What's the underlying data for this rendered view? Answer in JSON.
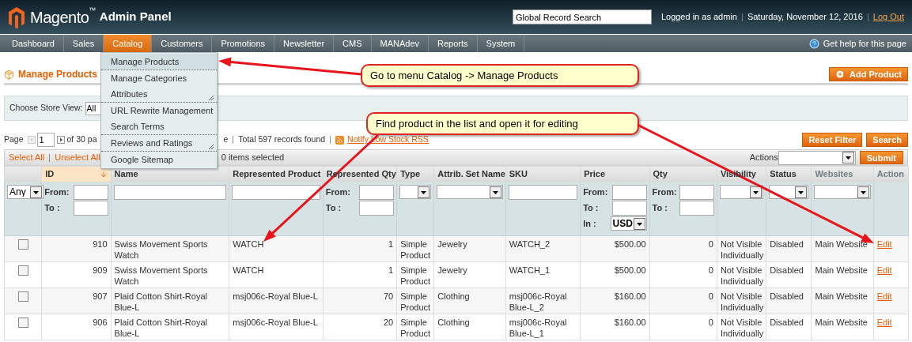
{
  "header": {
    "logo": "Magento",
    "trademark": "™",
    "logo_suffix": "Admin Panel",
    "search": {
      "value": "Global Record Search"
    },
    "user": "Logged in as admin",
    "date": "Saturday, November 12, 2016",
    "logout": "Log Out"
  },
  "nav": {
    "items": [
      {
        "label": "Dashboard",
        "selected": false
      },
      {
        "label": "Sales",
        "selected": false
      },
      {
        "label": "Catalog",
        "selected": true
      },
      {
        "label": "Customers",
        "selected": false
      },
      {
        "label": "Promotions",
        "selected": false
      },
      {
        "label": "Newsletter",
        "selected": false
      },
      {
        "label": "CMS",
        "selected": false
      },
      {
        "label": "MANAdev",
        "selected": false
      },
      {
        "label": "Reports",
        "selected": false
      },
      {
        "label": "System",
        "selected": false
      }
    ],
    "help": "Get help for this page"
  },
  "menu": {
    "groups": [
      {
        "items": [
          {
            "label": "Manage Products",
            "selected": true,
            "grip": false
          }
        ]
      },
      {
        "items": [
          {
            "label": "Manage Categories",
            "selected": false,
            "grip": false
          },
          {
            "label": "Attributes",
            "selected": false,
            "grip": true
          }
        ]
      },
      {
        "items": [
          {
            "label": "URL Rewrite Management",
            "selected": false,
            "grip": false
          },
          {
            "label": "Search Terms",
            "selected": false,
            "grip": false
          }
        ]
      },
      {
        "items": [
          {
            "label": "Reviews and Ratings",
            "selected": false,
            "grip": true
          }
        ]
      },
      {
        "items": [
          {
            "label": "Google Sitemap",
            "selected": false,
            "grip": false
          }
        ]
      }
    ]
  },
  "page_title": "Manage Products",
  "add_button": "Add Product",
  "store_view": {
    "label": "Choose Store View:",
    "value": "All"
  },
  "pager": {
    "label": "Page",
    "page": "1",
    "of": "of 30 pa",
    "after": "e",
    "total": "Total 597 records found",
    "rss": "Notify Low Stock RSS"
  },
  "filter_buttons": [
    "Reset Filter",
    "Search"
  ],
  "massaction": {
    "select_all": "Select All",
    "unselect_all": "Unselect All",
    "count": "0 items selected",
    "actions_label": "Actions",
    "submit": "Submit"
  },
  "table": {
    "columns": [
      {
        "label": "ID",
        "kind": "number",
        "sorted": true,
        "sortable": true
      },
      {
        "label": "Name",
        "kind": "text",
        "sorted": false,
        "sortable": true
      },
      {
        "label": "Represented Product",
        "kind": "text",
        "sorted": false,
        "sortable": true
      },
      {
        "label": "Represented Qty",
        "kind": "number",
        "sorted": false,
        "sortable": true
      },
      {
        "label": "Type",
        "kind": "text",
        "sorted": false,
        "sortable": true
      },
      {
        "label": "Attrib. Set Name",
        "kind": "text",
        "sorted": false,
        "sortable": true
      },
      {
        "label": "SKU",
        "kind": "text",
        "sorted": false,
        "sortable": true
      },
      {
        "label": "Price",
        "kind": "number",
        "sorted": false,
        "sortable": true
      },
      {
        "label": "Qty",
        "kind": "number",
        "sorted": false,
        "sortable": true
      },
      {
        "label": "Visibility",
        "kind": "text",
        "sorted": false,
        "sortable": true
      },
      {
        "label": "Status",
        "kind": "text",
        "sorted": false,
        "sortable": true
      },
      {
        "label": "Websites",
        "kind": "text",
        "sorted": false,
        "sortable": false
      },
      {
        "label": "Action",
        "kind": "action",
        "sorted": false,
        "sortable": false
      }
    ],
    "filters": [
      {
        "kind": "select",
        "value": "Any"
      },
      {
        "kind": "range",
        "from_label": "From:",
        "to_label": "To :"
      },
      {
        "kind": "text"
      },
      {
        "kind": "text"
      },
      {
        "kind": "range",
        "from_label": "From:",
        "to_label": "To :"
      },
      {
        "kind": "select"
      },
      {
        "kind": "select"
      },
      {
        "kind": "text"
      },
      {
        "kind": "price",
        "from_label": "From:",
        "to_label": "To :",
        "in_label": "In :",
        "currency": "USD"
      },
      {
        "kind": "range",
        "from_label": "From:",
        "to_label": "To :"
      },
      {
        "kind": "select"
      },
      {
        "kind": "select"
      },
      {
        "kind": "select"
      },
      {
        "kind": "empty"
      }
    ],
    "rows": [
      {
        "checked": false,
        "cells": [
          "910",
          "Swiss Movement Sports Watch",
          "WATCH",
          "1",
          "Simple Product",
          "Jewelry",
          "WATCH_2",
          "$500.00",
          "0",
          "Not Visible Individually",
          "Disabled",
          "Main Website",
          "Edit"
        ]
      },
      {
        "checked": false,
        "cells": [
          "909",
          "Swiss Movement Sports Watch",
          "WATCH",
          "1",
          "Simple Product",
          "Jewelry",
          "WATCH_1",
          "$500.00",
          "0",
          "Not Visible Individually",
          "Disabled",
          "Main Website",
          "Edit"
        ]
      },
      {
        "checked": false,
        "cells": [
          "907",
          "Plaid Cotton Shirt-Royal Blue-L",
          "msj006c-Royal Blue-L",
          "70",
          "Simple Product",
          "Clothing",
          "msj006c-Royal Blue-L_2",
          "$160.00",
          "0",
          "Not Visible Individually",
          "Disabled",
          "Main Website",
          "Edit"
        ]
      },
      {
        "checked": false,
        "cells": [
          "906",
          "Plaid Cotton Shirt-Royal Blue-L",
          "msj006c-Royal Blue-L",
          "20",
          "Simple Product",
          "Clothing",
          "msj006c-Royal Blue-L_1",
          "$160.00",
          "0",
          "Not Visible Individually",
          "Disabled",
          "Main Website",
          "Edit"
        ]
      }
    ]
  },
  "callouts": [
    "Go to menu Catalog -> Manage Products",
    "Find product in the list and open it for editing"
  ]
}
